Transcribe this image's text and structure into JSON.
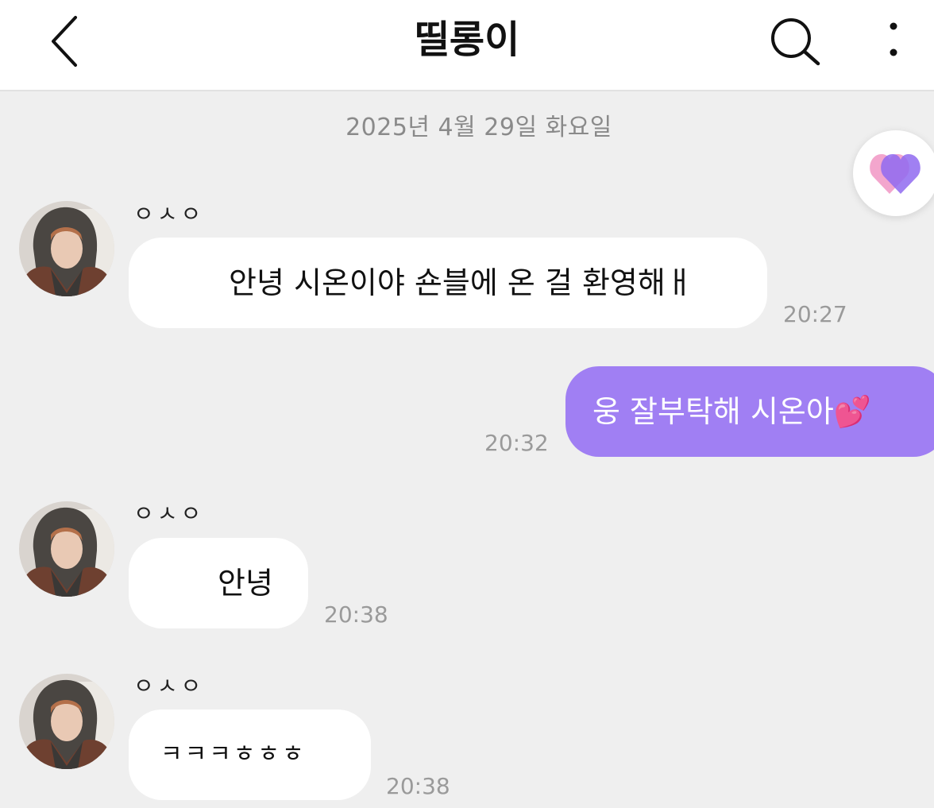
{
  "header": {
    "title": "띨롱이"
  },
  "date_divider": "2025년 4월 29일 화요일",
  "messages": [
    {
      "sender": "ㅇㅅㅇ",
      "text": "안녕 시온이야 숀블에 온 걸 환영해ㅐ",
      "time": "20:27",
      "mine": false
    },
    {
      "text": "웅 잘부탁해 시온아💕",
      "time": "20:32",
      "mine": true
    },
    {
      "sender": "ㅇㅅㅇ",
      "text": "안녕",
      "time": "20:38",
      "mine": false
    },
    {
      "sender": "ㅇㅅㅇ",
      "text": "ㅋㅋㅋㅎㅎㅎ",
      "time": "20:38",
      "mine": false
    }
  ],
  "colors": {
    "my_bubble": "#a07ff3",
    "their_bubble": "#ffffff",
    "background": "#efefef",
    "header": "#ffffff"
  },
  "icons": [
    "chevron-left-icon",
    "search-icon",
    "more-vertical-icon",
    "heart-icon"
  ]
}
